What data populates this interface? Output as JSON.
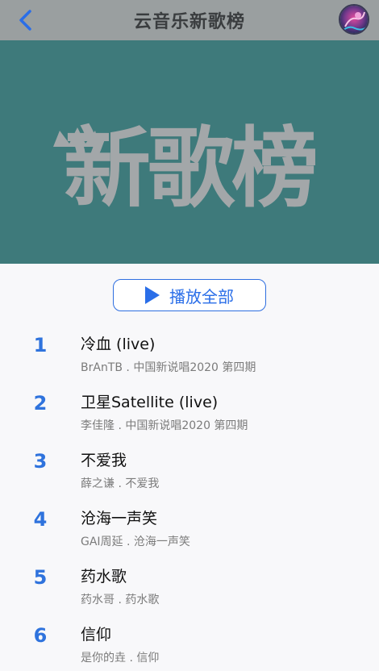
{
  "header": {
    "title": "云音乐新歌榜",
    "back_icon": "chevron-left-icon",
    "avatar_icon": "user-avatar"
  },
  "banner": {
    "text": "新歌榜"
  },
  "play_all": {
    "label": "播放全部",
    "icon": "play-icon"
  },
  "songs": [
    {
      "rank": "1",
      "title": "冷血 (live)",
      "meta": "BrAnTB . 中国新说唱2020 第四期"
    },
    {
      "rank": "2",
      "title": "卫星Satellite (live)",
      "meta": "李佳隆 . 中国新说唱2020 第四期"
    },
    {
      "rank": "3",
      "title": "不爱我",
      "meta": "薛之谦 . 不爱我"
    },
    {
      "rank": "4",
      "title": "沧海一声笑",
      "meta": "GAI周延 . 沧海一声笑"
    },
    {
      "rank": "5",
      "title": "药水歌",
      "meta": "药水哥 . 药水歌"
    },
    {
      "rank": "6",
      "title": "信仰",
      "meta": "是你的垚 . 信仰"
    }
  ],
  "colors": {
    "accent": "#2a6ee8",
    "topbar": "#9a9fa0",
    "banner": "#3e7a7b"
  }
}
